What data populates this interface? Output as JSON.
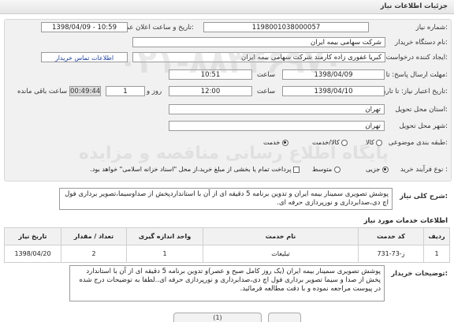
{
  "header": {
    "title": "جزئیات اطلاعات نیاز"
  },
  "form": {
    "need_number_label": "شماره نیاز:",
    "need_number": "1198001038000057",
    "announce_label": "تاریخ و ساعت اعلان عمومی:",
    "announce_value": "1398/04/09 - 10:59",
    "buyer_label": "نام دستگاه خریدار:",
    "buyer_value": "شرکت سهامی بیمه ایران",
    "creator_label": "ایجاد کننده درخواست:",
    "creator_value": "کبریا غفوری زاده کارمند شرکت سهامی بیمه ایران",
    "contact_link": "اطلاعات تماس خریدار",
    "deadline_label": "مهلت ارسال پاسخ: تا تاریخ:",
    "deadline_date": "1398/04/09",
    "time_label": "ساعت",
    "deadline_time": "10:51",
    "validity_label": "تاریخ اعتبار نیاز: تا تاریخ:",
    "validity_date": "1398/04/10",
    "validity_time": "12:00",
    "days_value": "1",
    "days_label": "روز و",
    "remaining_time": "00:49:44",
    "remaining_label": "ساعت باقی مانده",
    "province_label": "استان محل تحویل:",
    "province_value": "تهران",
    "city_label": "شهر محل تحویل:",
    "city_value": "تهران",
    "category_label": "طبقه بندی موضوعی:",
    "category_options": [
      "کالا",
      "کالا/خدمت",
      "خدمت"
    ],
    "process_label": "نوع فرآیند خرید :",
    "process_options": [
      "جزیی",
      "متوسط"
    ],
    "payment_note": "پرداخت تمام یا بخشی از مبلغ خرید،از محل \"اسناد خزانه اسلامی\" خواهد بود."
  },
  "summary": {
    "label": "شرح کلی نیاز:",
    "text": "پوشش تصویری سمینار بیمه ایران و تدوین برنامه 5 دقیقه ای از آن با استانداردپخش از صداوسیما،تصویر برداری فول اچ دی،صدابرداری و نورپردازی حرفه ای."
  },
  "services": {
    "section_title": "اطلاعات خدمات مورد نیاز",
    "columns": [
      "ردیف",
      "کد خدمت",
      "نام خدمت",
      "واحد اندازه گیری",
      "تعداد / مقدار",
      "تاریخ نیاز"
    ],
    "rows": [
      {
        "row": "1",
        "code": "ز-73-731",
        "name": "تبلیغات",
        "unit": "1",
        "qty": "2",
        "date": "1398/04/20"
      }
    ]
  },
  "buyer_notes": {
    "label": "توضیحات خریدار:",
    "text": "پوشش تصویری سمینار بیمه ایران (یک روز کامل صبح و عصر)و تدوین برنامه 5 دقیقه ای از آن با استاندارد پخش از صدا و سیما تصویر برداری فول اچ دی،صدابرداری و نورپردازی حرفه ای..لطفا به توضیحات درج شده در پیوست مراجعه نموده و با دقت مطالعه فرمائید."
  },
  "watermark": {
    "line1": "پایگاه اطلاع رسانی مناقصه و مزایده",
    "line2": "۰۲۱-۸۸۳۴۶۹۷۰"
  },
  "bottom": {
    "attachments_label": "(1)"
  }
}
